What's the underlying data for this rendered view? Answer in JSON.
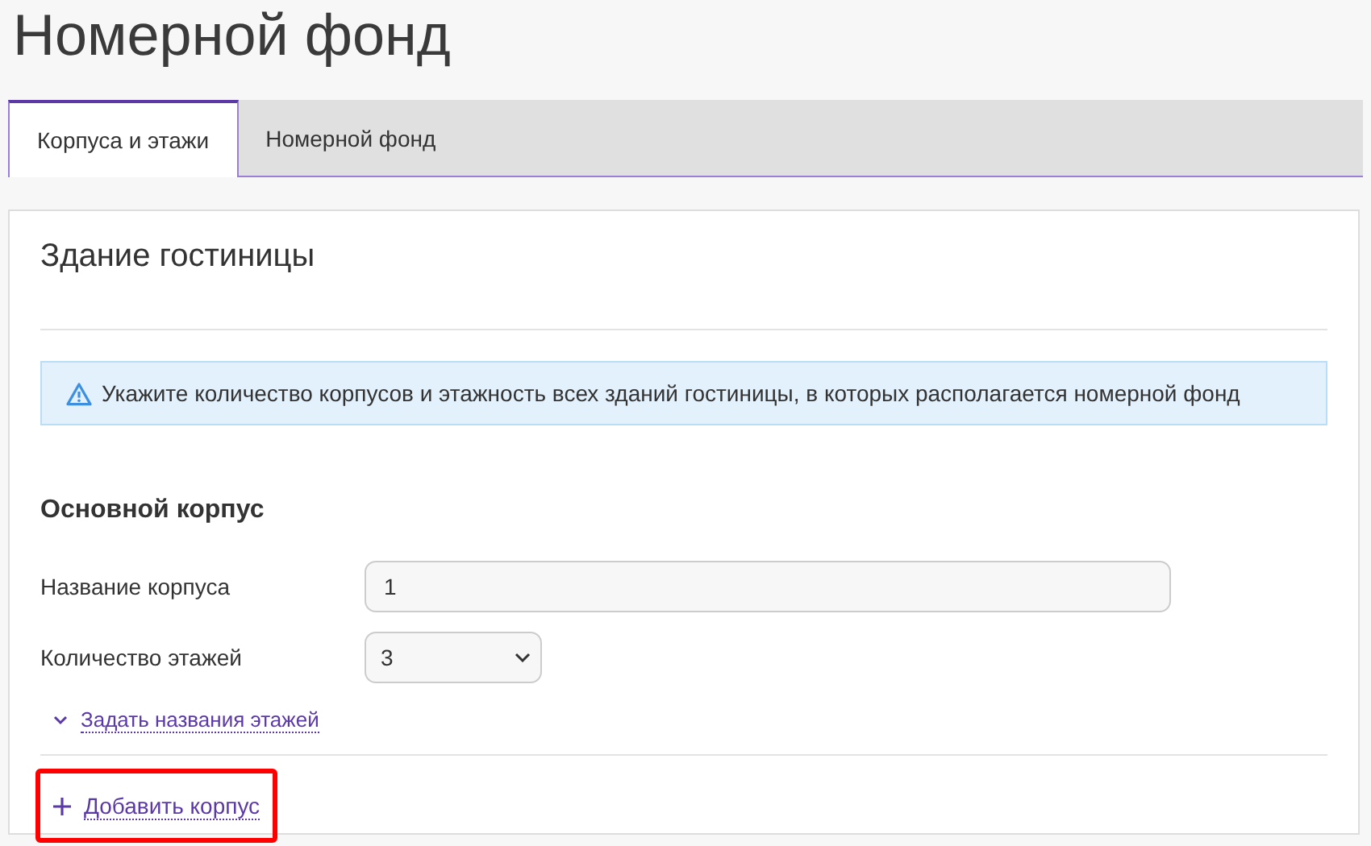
{
  "page_title": "Номерной фонд",
  "tabs": [
    {
      "label": "Корпуса и этажи",
      "selected": true
    },
    {
      "label": "Номерной фонд",
      "selected": false
    }
  ],
  "section_title": "Здание гостиницы",
  "alert": {
    "kind": "warning",
    "text": "Укажите количество корпусов и этажность всех зданий гостиницы, в которых располагается номерной фонд"
  },
  "building": {
    "title": "Основной корпус",
    "fields": [
      {
        "kind": "text",
        "label": "Название корпуса",
        "value": "1"
      },
      {
        "kind": "select",
        "label": "Количество этажей",
        "value": "3"
      }
    ],
    "floor_names_link": {
      "label": "Задать названия этажей",
      "expanded": false
    }
  },
  "add_building": {
    "label": "Добавить корпус",
    "highlighted": true
  }
}
